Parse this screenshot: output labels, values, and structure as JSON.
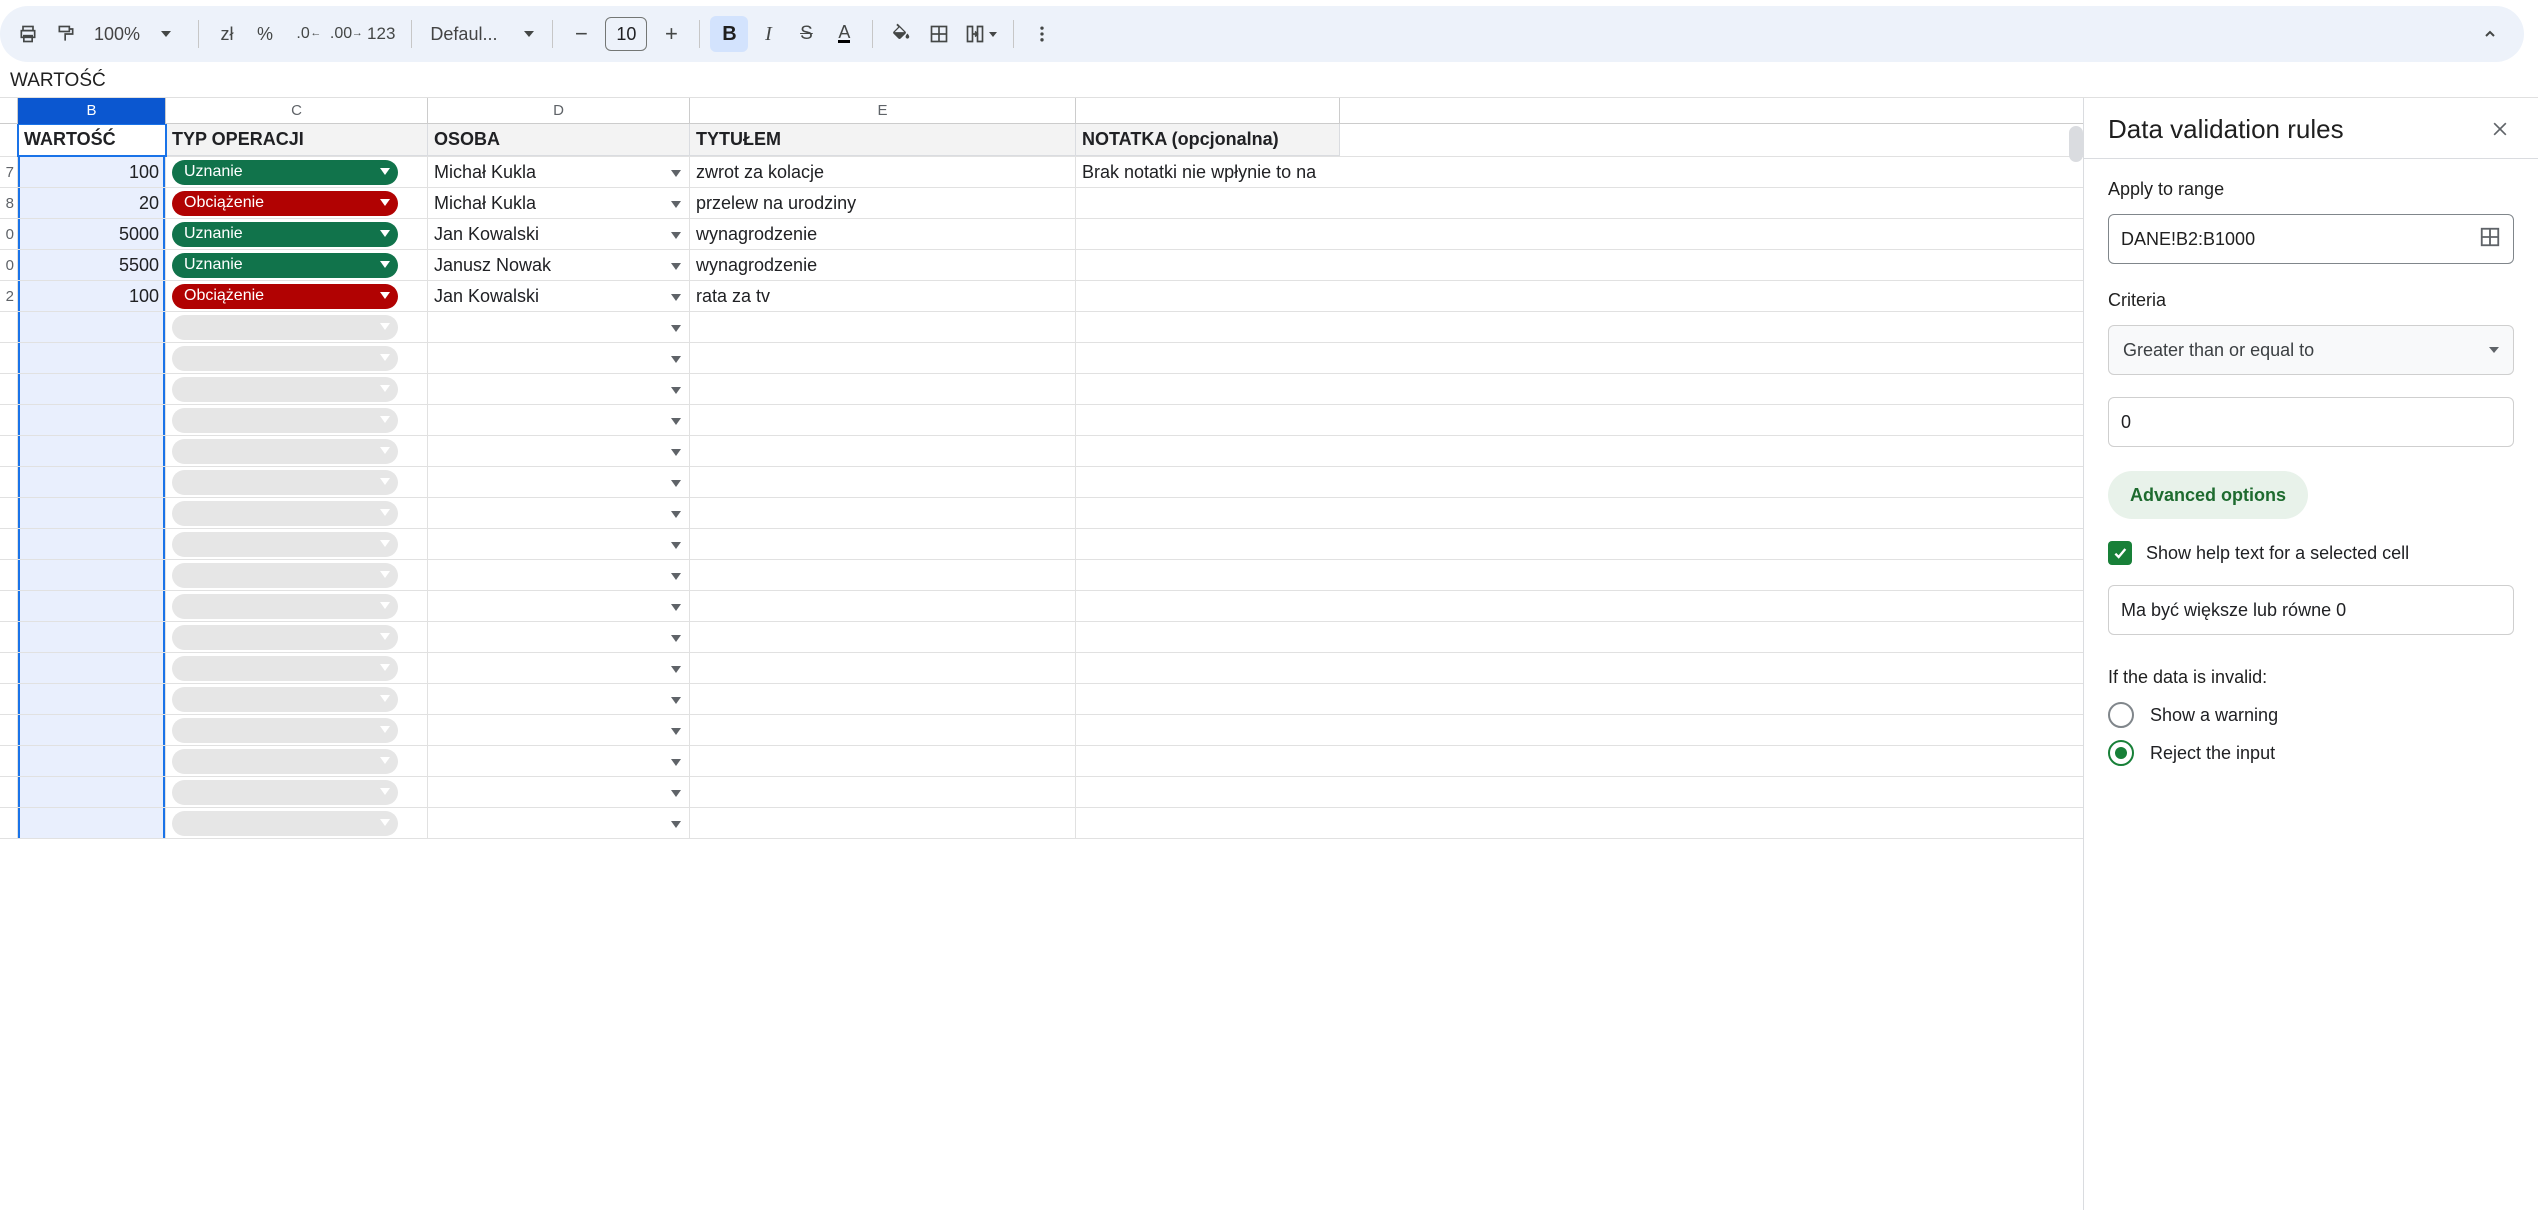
{
  "toolbar": {
    "zoom": "100%",
    "currency": "zł",
    "percent": "%",
    "dec_dec": ".0",
    "dec_inc": ".00",
    "numfmt": "123",
    "font": "Defaul...",
    "fontsize": "10",
    "bold": "B",
    "italic": "I",
    "strike": "S",
    "textcolor": "A"
  },
  "formula_bar": "WARTOŚĆ",
  "columns": {
    "b": "B",
    "c": "C",
    "d": "D",
    "e": "E"
  },
  "headers": {
    "b": "WARTOŚĆ",
    "c": "TYP OPERACJI",
    "d": "OSOBA",
    "e": "TYTUŁEM",
    "f": "NOTATKA (opcjonalna)"
  },
  "chips": {
    "uznanie": "Uznanie",
    "obciazenie": "Obciążenie"
  },
  "rows": [
    {
      "rn": "7",
      "v": "100",
      "chip": "green",
      "chipKey": "uznanie",
      "osoba": "Michał Kukla",
      "tytul": "zwrot za kolacje",
      "note": "Brak notatki nie wpłynie to na"
    },
    {
      "rn": "8",
      "v": "20",
      "chip": "red",
      "chipKey": "obciazenie",
      "osoba": "Michał Kukla",
      "tytul": "przelew na urodziny",
      "note": ""
    },
    {
      "rn": "0",
      "v": "5000",
      "chip": "green",
      "chipKey": "uznanie",
      "osoba": "Jan Kowalski",
      "tytul": "wynagrodzenie",
      "note": ""
    },
    {
      "rn": "0",
      "v": "5500",
      "chip": "green",
      "chipKey": "uznanie",
      "osoba": "Janusz Nowak",
      "tytul": "wynagrodzenie",
      "note": ""
    },
    {
      "rn": "2",
      "v": "100",
      "chip": "red",
      "chipKey": "obciazenie",
      "osoba": "Jan Kowalski",
      "tytul": "rata za tv",
      "note": ""
    }
  ],
  "empty_row_count": 17,
  "sidebar": {
    "title": "Data validation rules",
    "apply_label": "Apply to range",
    "range": "DANE!B2:B1000",
    "criteria_label": "Criteria",
    "criteria_value": "Greater than or equal to",
    "criteria_number": "0",
    "advanced": "Advanced options",
    "show_help_label": "Show help text for a selected cell",
    "help_text": "Ma być większe lub równe 0",
    "invalid_label": "If the data is invalid:",
    "opt_warning": "Show a warning",
    "opt_reject": "Reject the input"
  }
}
